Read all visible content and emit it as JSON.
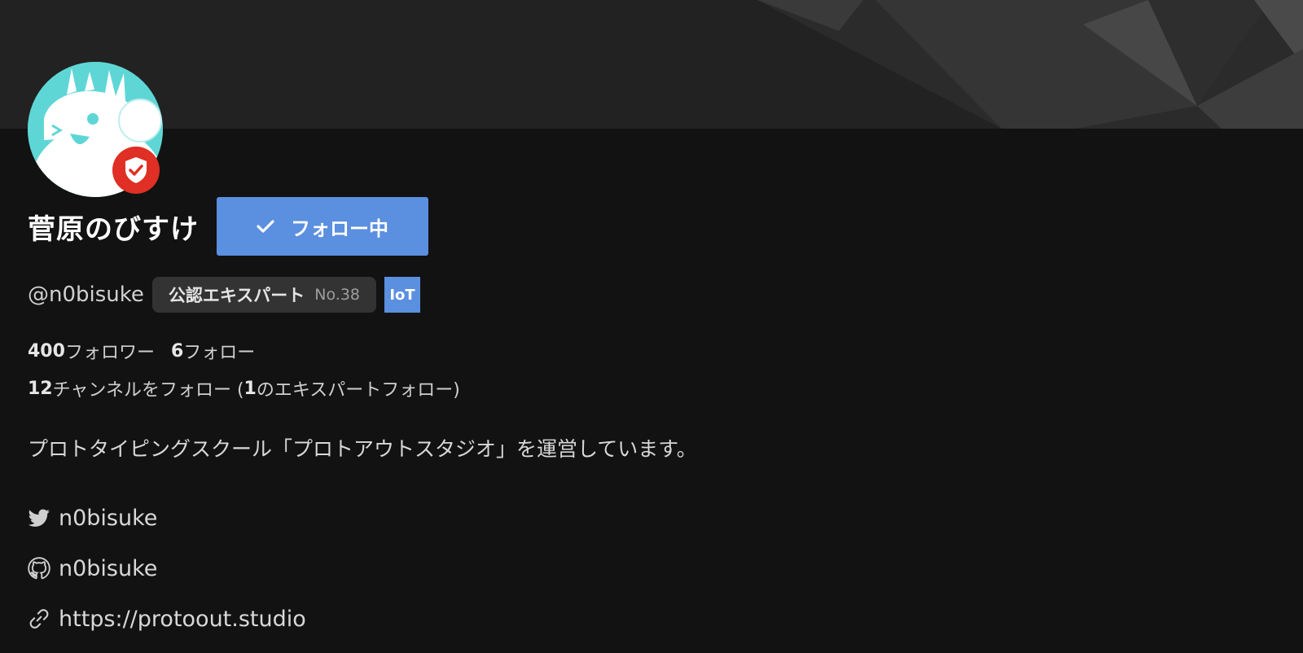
{
  "profile": {
    "name": "菅原のびすけ",
    "handle": "@n0bisuke",
    "follow_button": {
      "label": "フォロー中",
      "icon": "check-icon"
    },
    "expert_badge": {
      "label": "公認エキスパート",
      "number": "No.38"
    },
    "tag": "IoT",
    "stats": {
      "followers_count": "400",
      "followers_label": "フォロワー",
      "following_count": "6",
      "following_label": "フォロー",
      "channels_count": "12",
      "channels_label": "チャンネルをフォロー (",
      "expert_follow_count": "1",
      "expert_follow_label": "のエキスパートフォロー)"
    },
    "bio": "プロトタイピングスクール「プロトアウトスタジオ」を運営しています。",
    "links": {
      "twitter": "n0bisuke",
      "github": "n0bisuke",
      "website": "https://protoout.studio"
    }
  },
  "colors": {
    "background": "#121212",
    "cover": "#222222",
    "accent": "#5b8fdf",
    "badge_red": "#e02f24",
    "avatar_bg": "#5fd6d6"
  }
}
